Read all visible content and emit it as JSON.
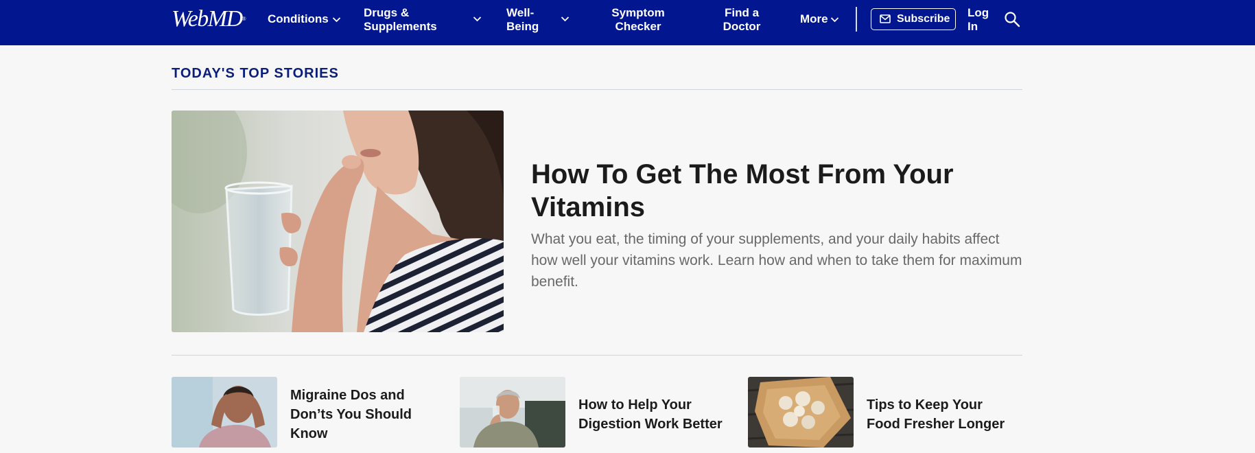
{
  "header": {
    "logo": "WebMD",
    "logo_mark": "®",
    "nav": {
      "conditions": "Conditions",
      "drugs_line1": "Drugs &",
      "drugs_line2": "Supplements",
      "wellbeing_line1": "Well-",
      "wellbeing_line2": "Being",
      "symptom_line1": "Symptom",
      "symptom_line2": "Checker",
      "doctor_line1": "Find a",
      "doctor_line2": "Doctor",
      "more": "More"
    },
    "subscribe": "Subscribe",
    "login_line1": "Log",
    "login_line2": "In",
    "icons": [
      "chevron-down-icon",
      "mail-icon",
      "search-icon"
    ],
    "bg_color": "#02178f"
  },
  "main": {
    "section_title": "TODAY'S TOP STORIES",
    "hero": {
      "title": "How To Get The Most From Your Vitamins",
      "description": "What you eat, the timing of your supplements, and your daily habits affect how well your vitamins work. Learn how and when to take them for maximum benefit."
    },
    "cards": [
      {
        "title_lines": [
          "Migraine Dos and",
          "Don’ts You Should",
          "Know"
        ]
      },
      {
        "title_lines": [
          "How to Help Your",
          "Digestion Work Better"
        ]
      },
      {
        "title_lines": [
          "Tips to Keep Your",
          "Food Fresher Longer"
        ]
      }
    ]
  },
  "colors": {
    "accent": "#0b1e7a",
    "text": "#1b1b1b",
    "muted": "#686868",
    "page_bg": "#f7f7f7"
  }
}
